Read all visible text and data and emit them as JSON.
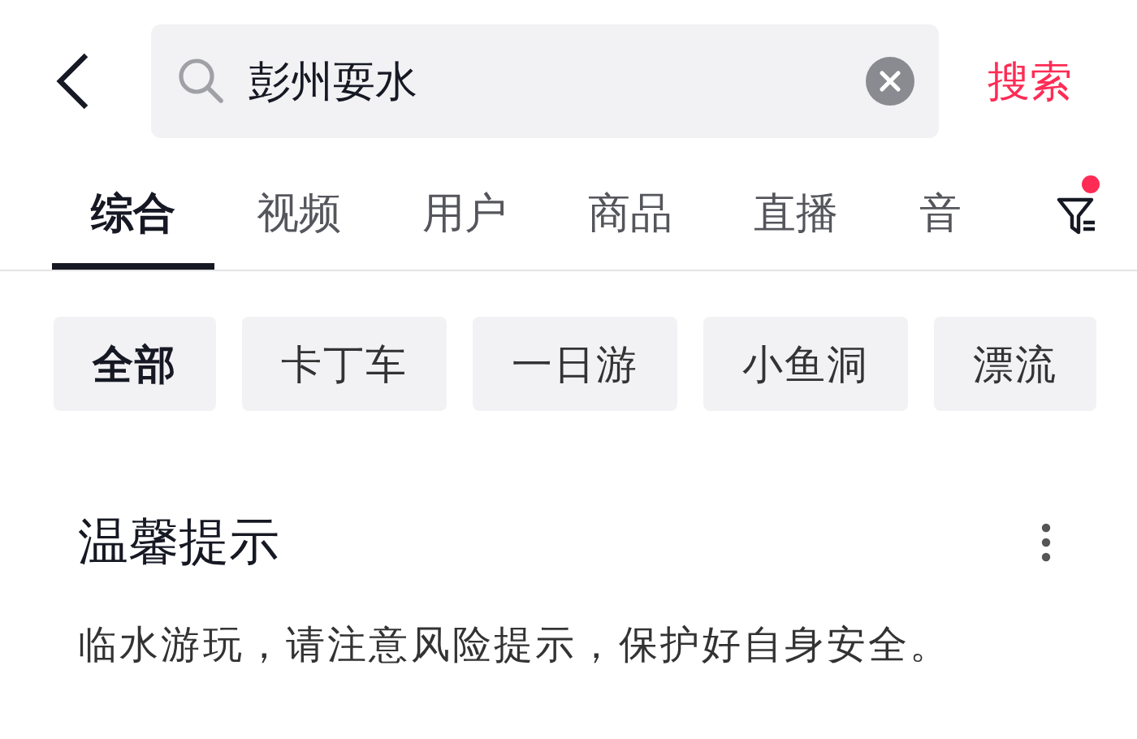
{
  "search": {
    "value": "彭州耍水",
    "action": "搜索"
  },
  "tabs": [
    {
      "label": "综合",
      "selected": true
    },
    {
      "label": "视频",
      "selected": false
    },
    {
      "label": "用户",
      "selected": false
    },
    {
      "label": "商品",
      "selected": false
    },
    {
      "label": "直播",
      "selected": false
    },
    {
      "label": "音",
      "selected": false
    }
  ],
  "filter": {
    "has_notification": true
  },
  "chips": [
    {
      "label": "全部",
      "selected": true
    },
    {
      "label": "卡丁车",
      "selected": false
    },
    {
      "label": "一日游",
      "selected": false
    },
    {
      "label": "小鱼洞",
      "selected": false
    },
    {
      "label": "漂流",
      "selected": false
    }
  ],
  "notice": {
    "title": "温馨提示",
    "text": "临水游玩，请注意风险提示，保护好自身安全。"
  }
}
